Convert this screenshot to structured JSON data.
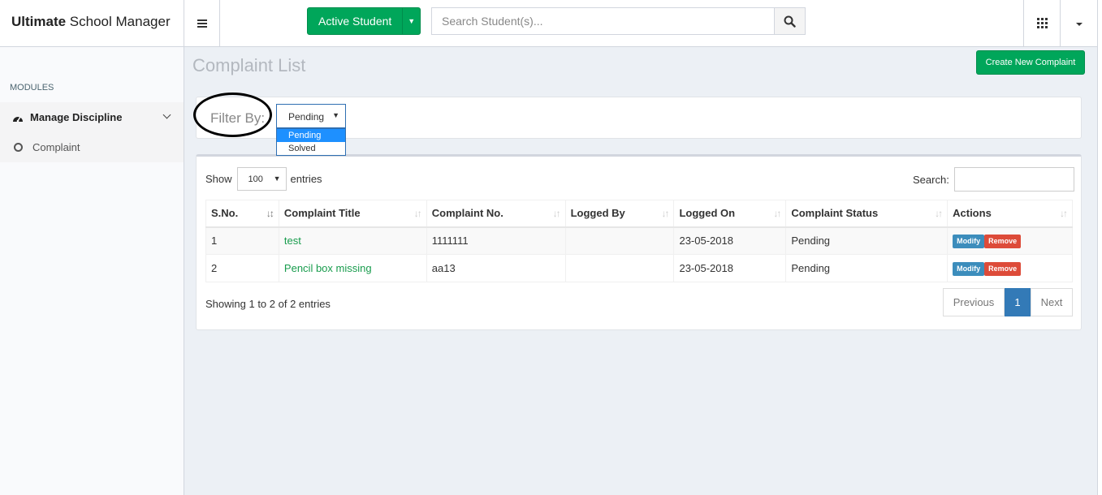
{
  "app": {
    "title_bold": "Ultimate",
    "title_rest": " School Manager"
  },
  "header": {
    "active_button": "Active Student",
    "search_placeholder": "Search Student(s)...",
    "icons": [
      "menu-icon",
      "search-icon",
      "apps-grid-icon",
      "caret-down-icon"
    ]
  },
  "sidebar": {
    "section": "MODULES",
    "menu": {
      "label": "Manage Discipline",
      "icon": "dashboard-icon"
    },
    "submenu": {
      "label": "Complaint",
      "icon": "circle-icon"
    }
  },
  "page": {
    "title": "Complaint List",
    "create_button": "Create New Complaint"
  },
  "filter": {
    "label": "Filter By:",
    "selected": "Pending",
    "options": [
      "Pending",
      "Solved"
    ]
  },
  "table": {
    "show_label": "Show",
    "page_length": "100",
    "entries_label": "entries",
    "search_label": "Search:",
    "columns": [
      "S.No.",
      "Complaint Title",
      "Complaint No.",
      "Logged By",
      "Logged On",
      "Complaint Status",
      "Actions"
    ],
    "rows": [
      {
        "sno": "1",
        "title": "test",
        "number": "1111111",
        "logged_by": "",
        "logged_on": "23-05-2018",
        "status": "Pending"
      },
      {
        "sno": "2",
        "title": "Pencil box missing",
        "number": "aa13",
        "logged_by": "",
        "logged_on": "23-05-2018",
        "status": "Pending"
      }
    ],
    "modify_label": "Modify",
    "remove_label": "Remove",
    "info": "Showing 1 to 2 of 2 entries",
    "pagination": {
      "previous": "Previous",
      "current": "1",
      "next": "Next"
    }
  },
  "colors": {
    "green": "#00a65a",
    "blue": "#3c8dbc",
    "red": "#dd4b39",
    "link": "#189c4d"
  }
}
